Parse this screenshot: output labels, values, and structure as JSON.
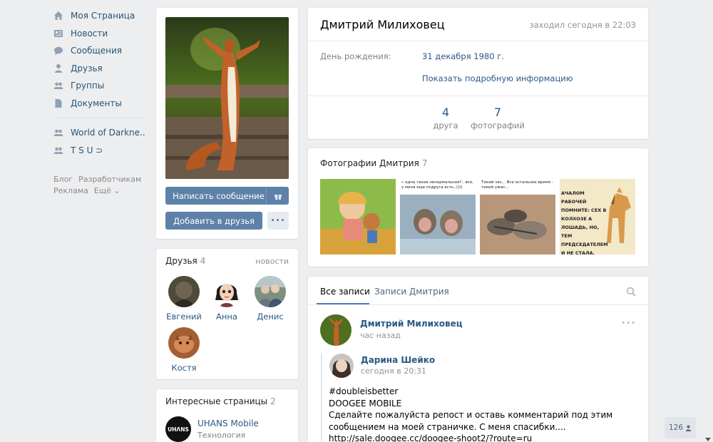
{
  "nav": {
    "items": [
      {
        "label": "Моя Страница",
        "icon": "home-icon"
      },
      {
        "label": "Новости",
        "icon": "news-icon"
      },
      {
        "label": "Сообщения",
        "icon": "messages-icon"
      },
      {
        "label": "Друзья",
        "icon": "friends-icon"
      },
      {
        "label": "Группы",
        "icon": "groups-icon"
      },
      {
        "label": "Документы",
        "icon": "documents-icon"
      }
    ],
    "groups": [
      {
        "label": "World of Darkne..",
        "icon": "group-icon"
      },
      {
        "label": "T S U ⊃",
        "icon": "group-icon"
      }
    ],
    "footer": {
      "blog": "Блог",
      "dev": "Разработчикам",
      "ads": "Реклама",
      "more": "Ещё ⌄"
    }
  },
  "profile": {
    "name": "Дмитрий Милиховец",
    "online": "заходил сегодня в 22:03",
    "birthday_label": "День рождения:",
    "birthday_value": "31 декабря 1980 г.",
    "show_more": "Показать подробную информацию",
    "stats": [
      {
        "value": "4",
        "label": "друга"
      },
      {
        "value": "7",
        "label": "фотографий"
      }
    ]
  },
  "actions": {
    "message": "Написать сообщение",
    "add_friend": "Добавить в друзья",
    "more": "•••"
  },
  "friends": {
    "title": "Друзья",
    "count": "4",
    "new_link": "новости",
    "list": [
      "Евгений",
      "Анна",
      "Денис",
      "Костя"
    ]
  },
  "pages": {
    "title": "Интересные страницы",
    "count": "2",
    "item_name": "UHANS Mobile",
    "item_sub": "Технология",
    "logo_text": "UHΛNS"
  },
  "photos": {
    "title": "Фотографии Дмитрия",
    "count": "7",
    "captions": [
      "",
      "« одна такая ненормальная?.. все, у меня еще подруга есть..))))",
      "Тихий час... Все остальное время - тихий ужас...",
      "АЧАЛОМ РАБОЧЕЙ ПОМНИТЕ: СЕХ В КОЛХОЗЕ А ЛОШАДЬ, НО, ТЕМ ПРЕДСЕДАТЕЛЕМ И НЕ СТАЛА."
    ]
  },
  "wall": {
    "tab_all": "Все записи",
    "tab_owner": "Записи Дмитрия",
    "post": {
      "author": "Дмитрий Милиховец",
      "time": "час назад",
      "repost_author": "Дарина Шейко",
      "repost_time": "сегодня в 20:31",
      "hashtag": "#doubleisbetter",
      "brand": "DOOGEE MOBILE",
      "text": "Сделайте пожалуйста репост и оставь комментарий под этим сообщением на моей страничке. С меня спасибки....",
      "link": "http://sale.doogee.cc/doogee-shoot2/?route=ru"
    }
  },
  "counter": {
    "value": "126"
  },
  "colors": {
    "accent": "#5181b8",
    "link": "#2a5885",
    "bg": "#edeef0"
  }
}
